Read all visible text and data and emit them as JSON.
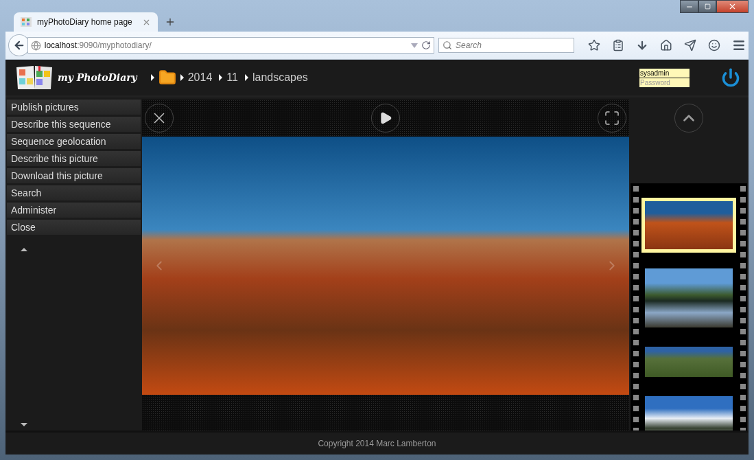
{
  "browser": {
    "tab": {
      "title": "myPhotoDiary home page",
      "selected": true
    },
    "url": {
      "host": "localhost",
      "path": ":9090/myphotodiary/"
    },
    "search": {
      "placeholder": "Search"
    }
  },
  "header": {
    "logo_text": "my PhotoDiary",
    "breadcrumb": [
      "2014",
      "11",
      "landscapes"
    ],
    "login": {
      "username": "sysadmin",
      "password_placeholder": "Password"
    }
  },
  "menu": [
    {
      "label": "Publish pictures"
    },
    {
      "label": "Describe this sequence"
    },
    {
      "label": "Sequence geolocation"
    },
    {
      "label": "Describe this picture"
    },
    {
      "label": "Download this picture"
    },
    {
      "label": "Search"
    },
    {
      "label": "Administer"
    },
    {
      "label": "Close"
    }
  ],
  "filmstrip": [
    {
      "kind": "desert",
      "selected": true
    },
    {
      "kind": "lake",
      "selected": false
    },
    {
      "kind": "valley",
      "selected": false
    },
    {
      "kind": "snow",
      "selected": false
    }
  ],
  "footer": {
    "copyright": "Copyright 2014 Marc Lamberton"
  }
}
